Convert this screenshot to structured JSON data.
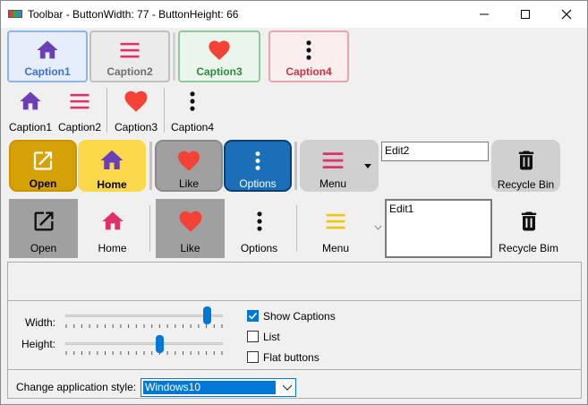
{
  "window": {
    "title": "Toolbar - ButtonWidth: 77 - ButtonHeight: 66"
  },
  "toolbar1": {
    "items": [
      {
        "label": "Caption1",
        "color": "#3a6fd8"
      },
      {
        "label": "Caption2",
        "color": "#6e6e6e"
      },
      {
        "label": "Caption3",
        "color": "#2f8a3a"
      },
      {
        "label": "Caption4",
        "color": "#c8333f"
      }
    ]
  },
  "toolbar2": {
    "items": [
      {
        "label": "Caption1"
      },
      {
        "label": "Caption2"
      },
      {
        "label": "Caption3"
      },
      {
        "label": "Caption4"
      }
    ]
  },
  "toolbar3": {
    "items": [
      {
        "label": "Open"
      },
      {
        "label": "Home"
      },
      {
        "label": "Like"
      },
      {
        "label": "Options"
      },
      {
        "label": "Menu"
      },
      {
        "label": "Recycle Bin"
      }
    ],
    "edit_value": "Edit2"
  },
  "toolbar4": {
    "items": [
      {
        "label": "Open"
      },
      {
        "label": "Home"
      },
      {
        "label": "Like"
      },
      {
        "label": "Options"
      },
      {
        "label": "Menu"
      },
      {
        "label": "Recycle Bim"
      }
    ],
    "edit_value": "Edit1"
  },
  "settings": {
    "width_label": "Width:",
    "height_label": "Height:",
    "width_value": 0.9,
    "height_value": 0.6,
    "show_captions_label": "Show Captions",
    "show_captions_checked": true,
    "list_label": "List",
    "list_checked": false,
    "flat_label": "Flat buttons",
    "flat_checked": false,
    "style_label": "Change application style:",
    "style_value": "Windows10"
  },
  "colors": {
    "accent": "#0078d7",
    "purple": "#6b3fb6",
    "pink": "#e0306a",
    "red": "#f44336",
    "gold": "#f5c400",
    "gold_light": "#fcd94b",
    "gray_btn": "#a0a0a0",
    "gray_light_btn": "#d0d0d0",
    "blue_btn": "#1a6fb8"
  },
  "icons": [
    "home-icon",
    "menu-icon",
    "heart-icon",
    "more-vertical-icon",
    "open-external-icon",
    "trash-icon"
  ]
}
